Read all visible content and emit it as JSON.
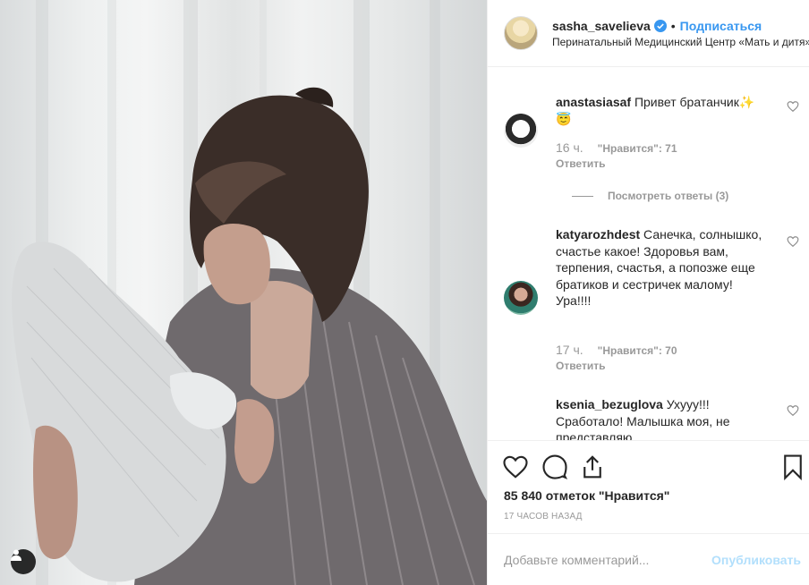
{
  "post": {
    "author": {
      "username": "sasha_savelieva",
      "verified": true,
      "follow_label": "Подписаться",
      "separator": "•",
      "location": "Перинатальный Медицинский Центр «Мать и дитя»"
    },
    "image_alt": "Photo of a woman holding a newborn",
    "comments": [
      {
        "username": "anastasiasaf",
        "text": "Привет братанчик✨ 😇",
        "time": "16 ч.",
        "likes": "\"Нравится\": 71",
        "reply_label": "Ответить",
        "view_replies": "Посмотреть ответы (3)"
      },
      {
        "username": "katyarozhdest",
        "text": "Санечка, солнышко, счастье какое! Здоровья вам, терпения, счастья, а попозже еще братиков и сестричек малому! Ура!!!!",
        "time": "17 ч.",
        "likes": "\"Нравится\": 70",
        "reply_label": "Ответить"
      },
      {
        "username": "ksenia_bezuglova",
        "text": "Ухууу!!! Сработало! Малышка моя, не представляю",
        "time": "",
        "likes": "",
        "reply_label": ""
      }
    ],
    "likes_text": "85 840 отметок \"Нравится\"",
    "time_ago": "17 ЧАСОВ НАЗАД",
    "comment_input": {
      "placeholder": "Добавьте комментарий...",
      "value": ""
    },
    "publish_label": "Опубликовать"
  },
  "icons": {
    "like": "heart-icon",
    "comment": "comment-icon",
    "share": "share-icon",
    "save": "bookmark-icon",
    "tag": "person-tag-icon",
    "verified": "verified-badge-icon"
  },
  "colors": {
    "link": "#3897f0",
    "muted": "#999999",
    "border": "#efefef",
    "publish_disabled": "#b2dffc",
    "text": "#262626"
  }
}
